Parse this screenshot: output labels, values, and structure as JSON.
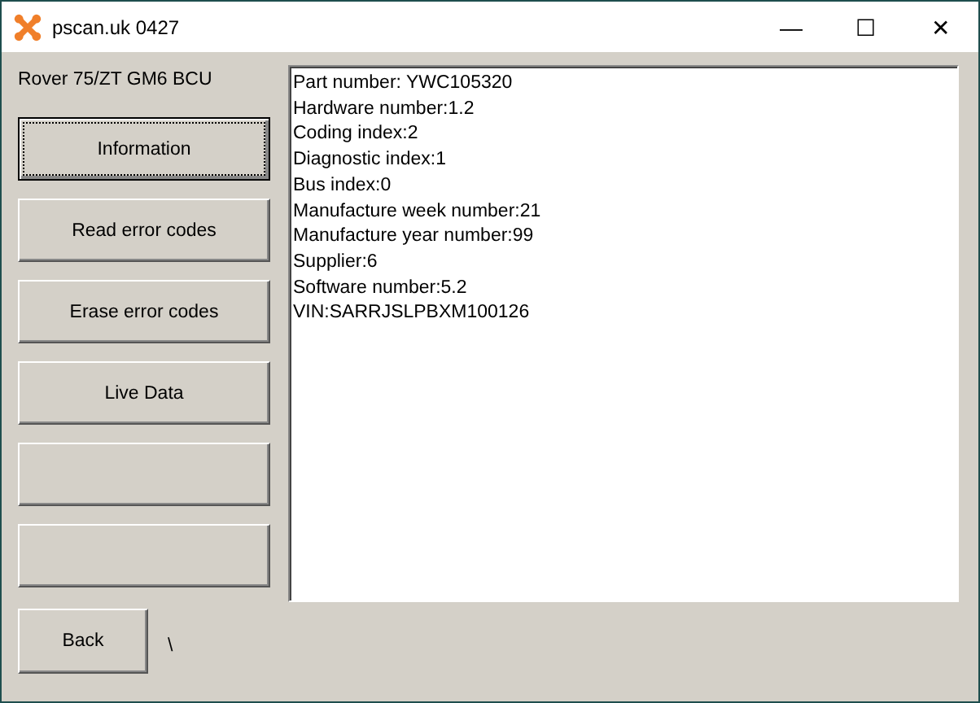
{
  "window": {
    "title": "pscan.uk 0427",
    "controls": [
      "—",
      "☐",
      "✕"
    ]
  },
  "module_label": "Rover 75/ZT GM6 BCU",
  "buttons": [
    {
      "label": "Information",
      "focused": true
    },
    {
      "label": "Read error codes",
      "focused": false
    },
    {
      "label": "Erase error codes",
      "focused": false
    },
    {
      "label": "Live Data",
      "focused": false
    },
    {
      "focused": false
    },
    {
      "focused": false
    }
  ],
  "info_lines": [
    "Part number: YWC105320",
    "Hardware number:1.2",
    "Coding index:2",
    "Diagnostic index:1",
    "Bus index:0",
    "Manufacture week number:21",
    "Manufacture year number:99",
    "Supplier:6",
    "Software number:5.2",
    "VIN:SARRJSLPBXM100126"
  ],
  "back_button": {
    "label": "Back"
  },
  "status_text": "\\"
}
